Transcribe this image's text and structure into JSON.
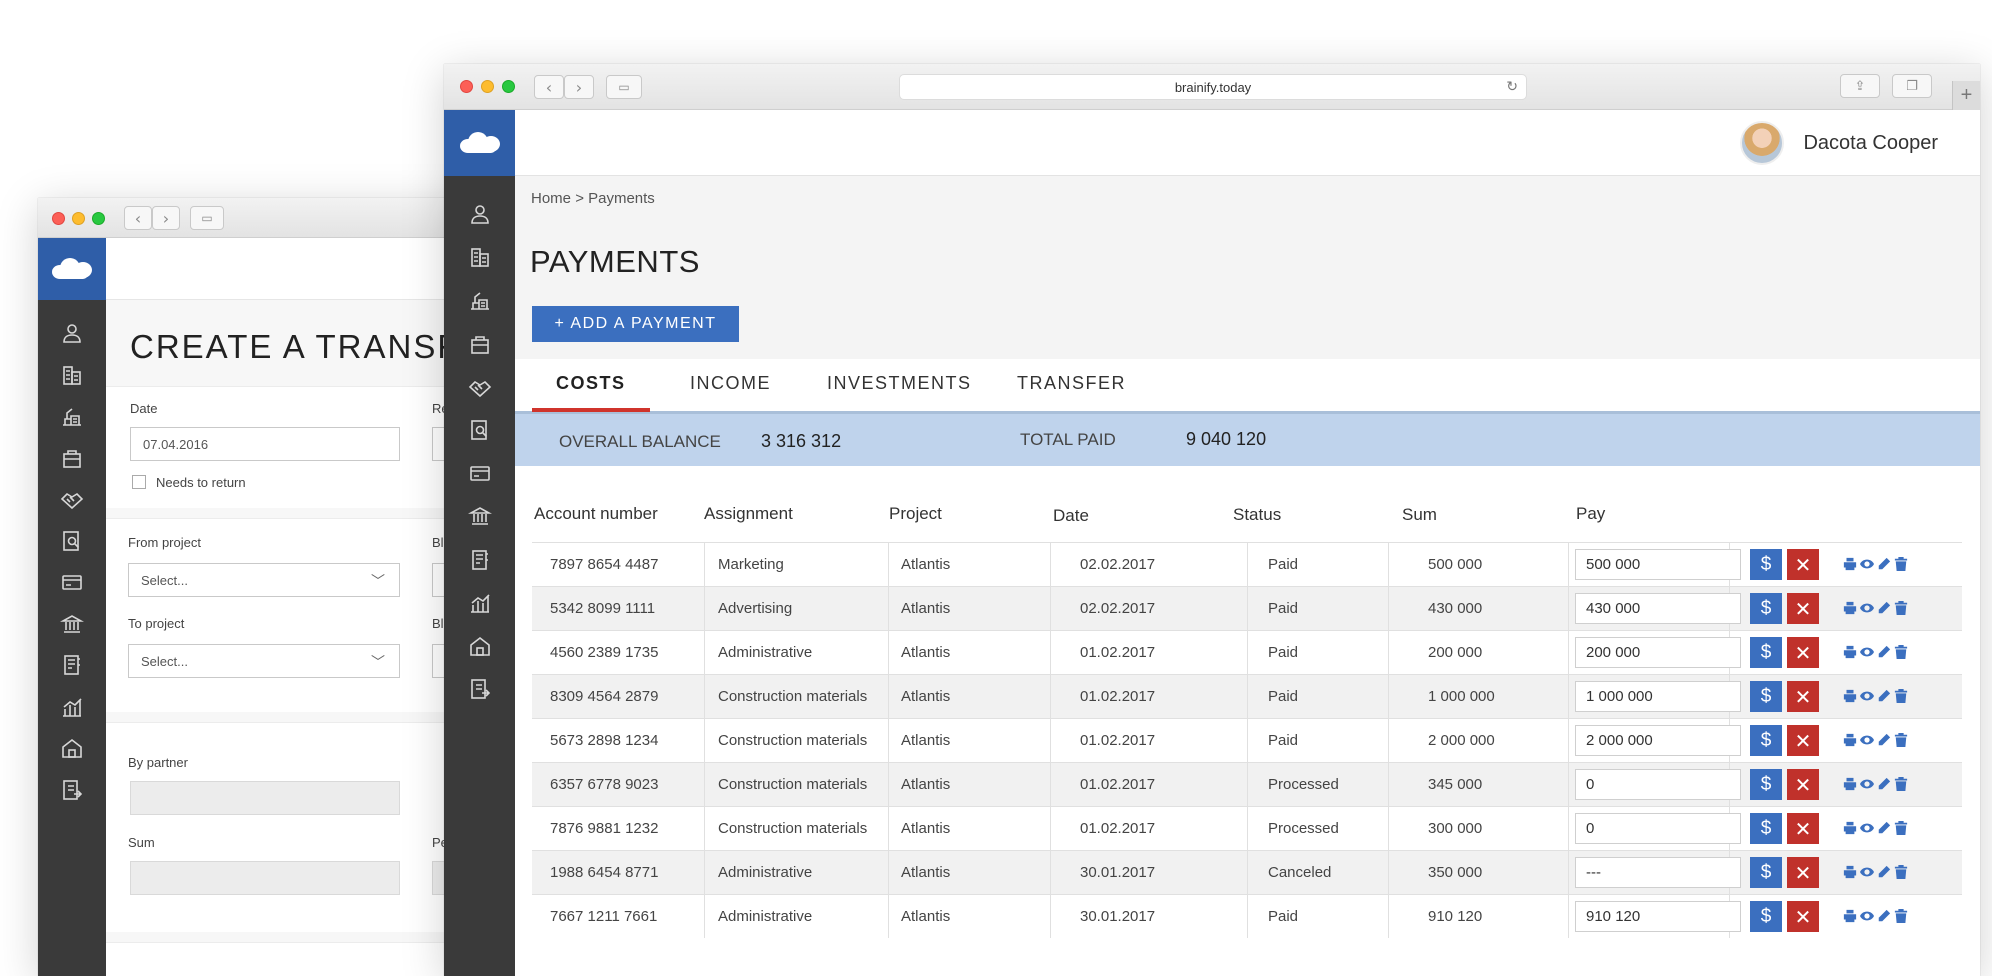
{
  "back_window": {
    "title": "CREATE A TRANSFE",
    "date_label": "Date",
    "date_value": "07.04.2016",
    "needs_to_return_label": "Needs to return",
    "from_project_label": "From project",
    "from_project_value": "Select...",
    "to_project_label": "To project",
    "to_project_value": "Select...",
    "by_partner_label": "By partner",
    "sum_label": "Sum",
    "right_col_labels": [
      "Re",
      "Bl",
      "Bl",
      "Pe"
    ]
  },
  "browser": {
    "url": "brainify.today"
  },
  "header": {
    "user_name": "Dacota Cooper"
  },
  "breadcrumb": {
    "home": "Home",
    "current": "> Payments"
  },
  "page": {
    "title": "PAYMENTS",
    "add_button": "+ ADD A PAYMENT"
  },
  "tabs": [
    {
      "label": "COSTS",
      "active": true
    },
    {
      "label": "INCOME",
      "active": false
    },
    {
      "label": "INVESTMENTS",
      "active": false
    },
    {
      "label": "TRANSFER",
      "active": false
    }
  ],
  "balance": {
    "overall_label": "OVERALL BALANCE",
    "overall_value": "3 316 312",
    "total_paid_label": "TOTAL PAID",
    "total_paid_value": "9 040 120"
  },
  "table": {
    "columns": [
      "Account number",
      "Assignment",
      "Project",
      "Date",
      "Status",
      "Sum",
      "Pay"
    ],
    "rows": [
      {
        "account": "7897 8654 4487",
        "assignment": "Marketing",
        "project": "Atlantis",
        "date": "02.02.2017",
        "status": "Paid",
        "sum": "500 000",
        "pay": "500 000"
      },
      {
        "account": "5342 8099 1111",
        "assignment": "Advertising",
        "project": "Atlantis",
        "date": "02.02.2017",
        "status": "Paid",
        "sum": "430 000",
        "pay": "430 000"
      },
      {
        "account": "4560 2389 1735",
        "assignment": "Administrative",
        "project": "Atlantis",
        "date": "01.02.2017",
        "status": "Paid",
        "sum": "200 000",
        "pay": "200 000"
      },
      {
        "account": "8309 4564 2879",
        "assignment": "Construction materials",
        "project": "Atlantis",
        "date": "01.02.2017",
        "status": "Paid",
        "sum": "1 000 000",
        "pay": "1 000 000"
      },
      {
        "account": "5673 2898 1234",
        "assignment": "Construction materials",
        "project": "Atlantis",
        "date": "01.02.2017",
        "status": "Paid",
        "sum": "2 000 000",
        "pay": "2 000 000"
      },
      {
        "account": "6357 6778 9023",
        "assignment": "Construction materials",
        "project": "Atlantis",
        "date": "01.02.2017",
        "status": "Processed",
        "sum": "345 000",
        "pay": "0"
      },
      {
        "account": "7876 9881 1232",
        "assignment": "Construction materials",
        "project": "Atlantis",
        "date": "01.02.2017",
        "status": "Processed",
        "sum": "300 000",
        "pay": "0"
      },
      {
        "account": "1988 6454 8771",
        "assignment": "Administrative",
        "project": "Atlantis",
        "date": "30.01.2017",
        "status": "Canceled",
        "sum": "350 000",
        "pay": "---"
      },
      {
        "account": "7667 1211 7661",
        "assignment": "Administrative",
        "project": "Atlantis",
        "date": "30.01.2017",
        "status": "Paid",
        "sum": "910 120",
        "pay": "910 120"
      }
    ],
    "pay_button_symbol": "$",
    "cancel_button_symbol": "✕",
    "row_action_icons": [
      "print-icon",
      "view-icon",
      "edit-icon",
      "delete-icon"
    ]
  },
  "sidebar_icons": [
    "user-icon",
    "buildings-icon",
    "construction-icon",
    "box-icon",
    "handshake-icon",
    "document-search-icon",
    "card-icon",
    "bank-icon",
    "notebook-icon",
    "chart-icon",
    "house-icon",
    "export-icon"
  ],
  "colors": {
    "brand_blue": "#3b6fbf",
    "sidebar": "#3a3a3a",
    "logo_bg": "#2f5ea8",
    "danger_red": "#c0312b",
    "balance_bar": "#bfd3ec",
    "active_tab_underline": "#d0342c"
  }
}
